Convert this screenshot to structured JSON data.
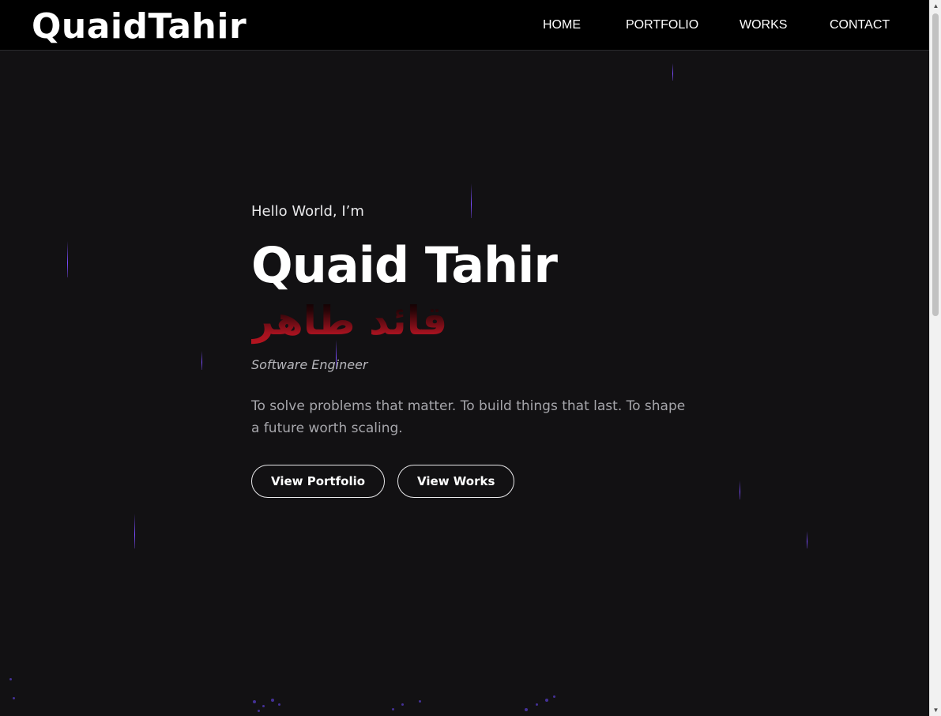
{
  "header": {
    "logo": "QuaidTahir",
    "nav": [
      {
        "label": "HOME",
        "active": true
      },
      {
        "label": "PORTFOLIO",
        "active": false
      },
      {
        "label": "WORKS",
        "active": false
      },
      {
        "label": "CONTACT",
        "active": false
      }
    ]
  },
  "hero": {
    "greeting": "Hello World, I’m",
    "name": "Quaid Tahir",
    "arabic_name": "قائد طاهر",
    "role": "Software Engineer",
    "tagline": "To solve problems that matter. To build things that last. To shape a future worth scaling.",
    "buttons": {
      "portfolio": "View Portfolio",
      "works": "View Works"
    }
  },
  "colors": {
    "background": "#121113",
    "header_background": "#000000",
    "nav_active_underline_start": "#a646d6",
    "nav_active_underline_end": "#e8356e",
    "arabic_name_color": "#b5141f",
    "streak_color": "#7a4cff"
  },
  "icons": {
    "scroll_up": "chevron-up-icon",
    "scroll_down": "chevron-down-icon"
  }
}
